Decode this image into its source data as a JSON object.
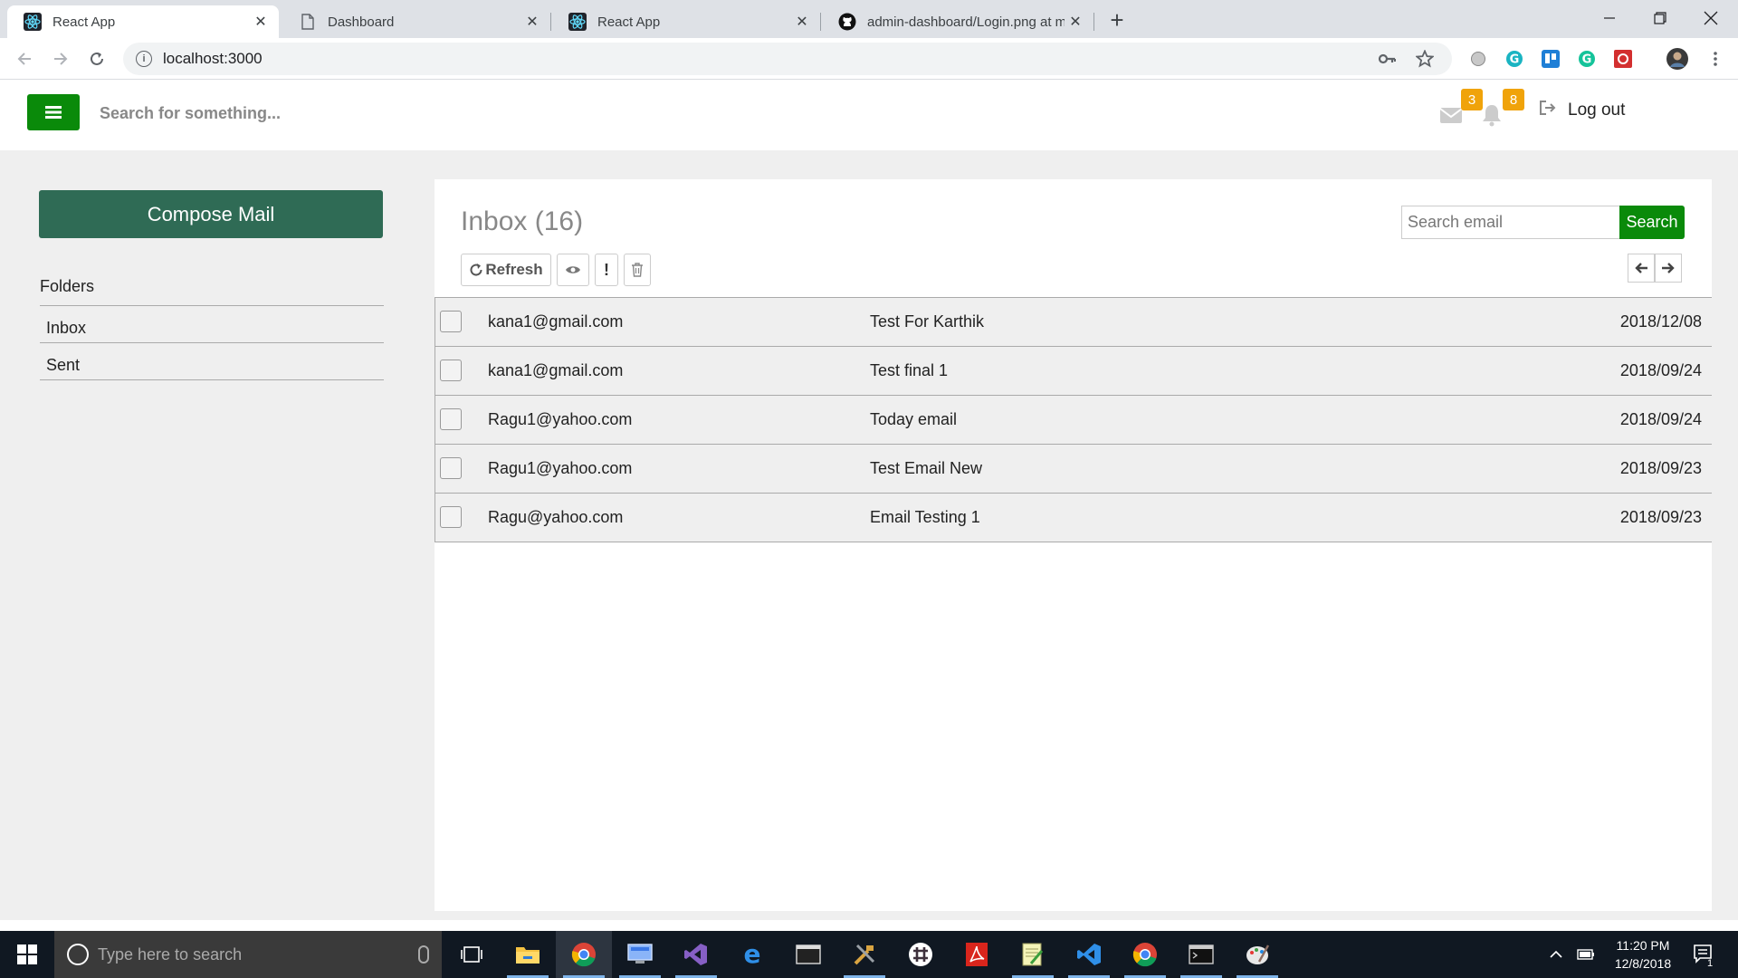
{
  "browser": {
    "tabs": [
      {
        "title": "React App",
        "icon": "react-icon",
        "active": true
      },
      {
        "title": "Dashboard",
        "icon": "page-icon",
        "active": false
      },
      {
        "title": "React App",
        "icon": "react-icon",
        "active": false
      },
      {
        "title": "admin-dashboard/Login.png at m",
        "icon": "github-icon",
        "active": false
      }
    ],
    "url": "localhost:3000"
  },
  "header": {
    "search_placeholder": "Search for something...",
    "mail_badge": "3",
    "notification_badge": "8",
    "logout_label": "Log out"
  },
  "sidebar": {
    "compose_label": "Compose Mail",
    "folders_heading": "Folders",
    "folders": [
      "Inbox",
      "Sent"
    ]
  },
  "inbox": {
    "title": "Inbox (16)",
    "search_placeholder": "Search email",
    "search_button": "Search",
    "refresh_label": "Refresh",
    "emails": [
      {
        "from": "kana1@gmail.com",
        "subject": "Test For Karthik",
        "date": "2018/12/08"
      },
      {
        "from": "kana1@gmail.com",
        "subject": "Test final 1",
        "date": "2018/09/24"
      },
      {
        "from": "Ragu1@yahoo.com",
        "subject": "Today email",
        "date": "2018/09/24"
      },
      {
        "from": "Ragu1@yahoo.com",
        "subject": "Test Email New",
        "date": "2018/09/23"
      },
      {
        "from": "Ragu@yahoo.com",
        "subject": "Email Testing 1",
        "date": "2018/09/23"
      }
    ]
  },
  "taskbar": {
    "search_placeholder": "Type here to search",
    "time": "11:20 PM",
    "date": "12/8/2018",
    "notification_count": "1"
  },
  "colors": {
    "accent_green": "#0a8a0a",
    "compose_green": "#2f6b55",
    "badge_orange": "#f0a30a"
  }
}
